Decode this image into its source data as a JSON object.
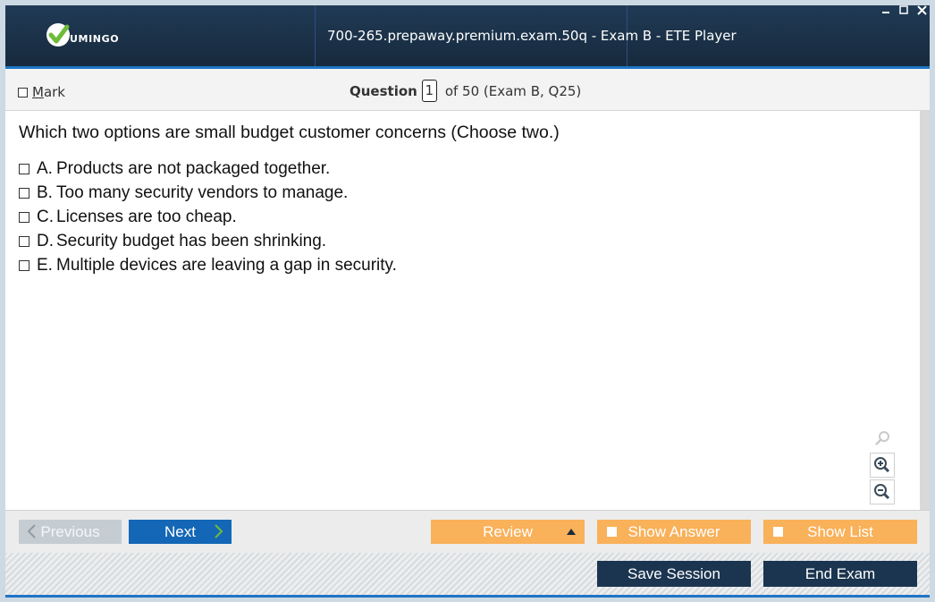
{
  "window": {
    "title": "700-265.prepaway.premium.exam.50q - Exam B - ETE Player",
    "logo_text": "UMINGO",
    "controls": [
      "minimize",
      "maximize",
      "close"
    ]
  },
  "question_header": {
    "mark_label_first": "M",
    "mark_label_rest": "ark",
    "question_word": "Question",
    "question_number": "1",
    "of_text": "of 50 (Exam B, Q25)"
  },
  "question": {
    "text": "Which two options are small budget customer concerns (Choose two.)",
    "options": [
      {
        "letter": "A.",
        "text": "Products are not packaged together."
      },
      {
        "letter": "B.",
        "text": "Too many security vendors to manage."
      },
      {
        "letter": "C.",
        "text": "Licenses are too cheap."
      },
      {
        "letter": "D.",
        "text": "Security budget has been shrinking."
      },
      {
        "letter": "E.",
        "text": "Multiple devices are leaving a gap in security."
      }
    ]
  },
  "zoom_tools": [
    "search-icon",
    "zoom-in-icon",
    "zoom-out-icon"
  ],
  "nav": {
    "previous": "Previous",
    "next": "Next",
    "review": "Review",
    "show_answer": "Show Answer",
    "show_list": "Show List"
  },
  "footer": {
    "save_session": "Save Session",
    "end_exam": "End Exam"
  },
  "colors": {
    "titlebar": "#1d3349",
    "accent": "#1e75c6",
    "next_button": "#1467b6",
    "orange_button": "#f9b15a",
    "dark_button": "#1b3550",
    "logo_green": "#6dbb3a"
  }
}
